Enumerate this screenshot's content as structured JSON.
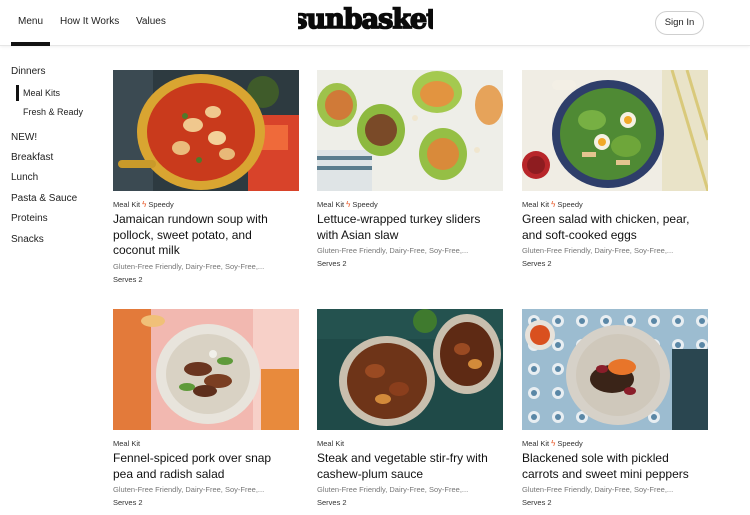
{
  "header": {
    "nav": [
      "Menu",
      "How It Works",
      "Values"
    ],
    "logo_text": "sunbasket",
    "signin_label": "Sign In"
  },
  "sidebar": {
    "items": [
      "Dinners",
      "Meal Kits",
      "Fresh & Ready",
      "NEW!",
      "Breakfast",
      "Lunch",
      "Pasta & Sauce",
      "Proteins",
      "Snacks"
    ]
  },
  "recipes": [
    {
      "tag": "Meal Kit",
      "badge": "Speedy",
      "title_1": "Jamaican rundown soup with",
      "title_2": "pollock, sweet potato, and",
      "title_3": "coconut milk",
      "diet": "Gluten-Free Friendly, Dairy-Free, Soy-Free,...",
      "serves": "Serves 2",
      "image": "jamaican-soup-photo"
    },
    {
      "tag": "Meal Kit",
      "badge": "Speedy",
      "title_1": "Lettuce-wrapped turkey sliders",
      "title_2": "with Asian slaw",
      "diet": "Gluten-Free Friendly, Dairy-Free, Soy-Free,...",
      "serves": "Serves 2",
      "image": "turkey-sliders-photo"
    },
    {
      "tag": "Meal Kit",
      "badge": "Speedy",
      "title_1": "Green salad with chicken, pear,",
      "title_2": "and soft-cooked eggs",
      "diet": "Gluten-Free Friendly, Dairy-Free, Soy-Free,...",
      "serves": "Serves 2",
      "image": "green-salad-photo"
    },
    {
      "tag": "Meal Kit",
      "title_1": "Fennel-spiced pork over snap",
      "title_2": "pea and radish salad",
      "diet": "Gluten-Free Friendly, Dairy-Free, Soy-Free,...",
      "serves": "Serves 2",
      "image": "fennel-pork-photo"
    },
    {
      "tag": "Meal Kit",
      "title_1": "Steak and vegetable stir-fry with",
      "title_2": "cashew-plum sauce",
      "diet": "Gluten-Free Friendly, Dairy-Free, Soy-Free,...",
      "serves": "Serves 2",
      "image": "steak-stirfry-photo"
    },
    {
      "tag": "Meal Kit",
      "badge": "Speedy",
      "title_1": "Blackened sole with pickled",
      "title_2": "carrots and sweet mini peppers",
      "diet": "Gluten-Free Friendly, Dairy-Free, Soy-Free,...",
      "serves": "Serves 2",
      "image": "blackened-sole-photo"
    }
  ],
  "icons": {
    "speedy": "lightning-bolt-icon"
  },
  "colors": {
    "accent": "#e85a2a",
    "text": "#111111",
    "muted": "#777777"
  }
}
